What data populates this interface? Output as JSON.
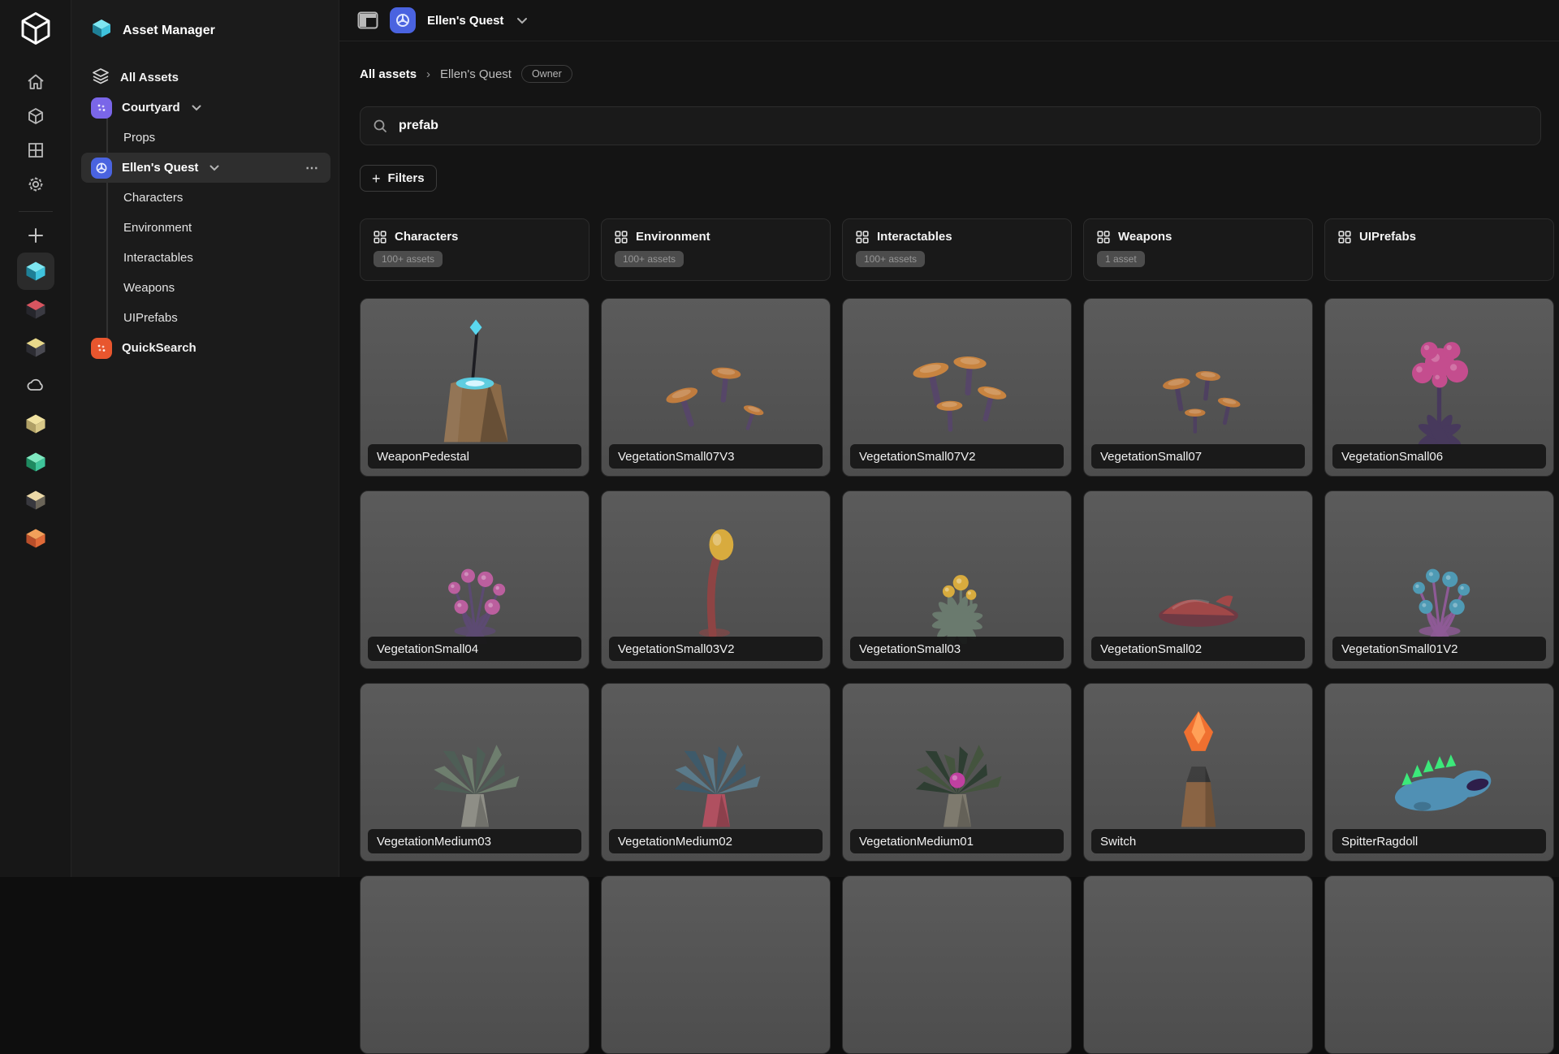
{
  "app_title": "Asset Manager",
  "colors": {
    "accent_blue": "#4a63e0",
    "purple": "#7a66e8",
    "orange": "#e8562e",
    "teal": "#3fc3dd",
    "card_grey": "#555555"
  },
  "rail": {
    "nav": [
      {
        "name": "home-icon"
      },
      {
        "name": "cube-icon"
      },
      {
        "name": "grid-icon"
      },
      {
        "name": "settings-gear-icon"
      }
    ],
    "add": {
      "name": "add-project-icon"
    },
    "projects": [
      {
        "name": "project-teal-cube",
        "selected": true,
        "kind": "cube",
        "top": "#7ee7f2",
        "left": "#1e7f96",
        "right": "#3fc3dd"
      },
      {
        "name": "project-red-cube",
        "selected": false,
        "kind": "cube",
        "top": "#d85560",
        "left": "#26262c",
        "right": "#3a3a42"
      },
      {
        "name": "project-amber-cube",
        "selected": false,
        "kind": "cube",
        "top": "#e8d88a",
        "left": "#2c2c32",
        "right": "#4a4a52"
      },
      {
        "name": "project-cloud",
        "selected": false,
        "kind": "cloud",
        "top": "#cccccc",
        "left": "#cccccc",
        "right": "#cccccc"
      },
      {
        "name": "project-cream-cube",
        "selected": false,
        "kind": "cube",
        "top": "#f0e2a0",
        "left": "#b0a066",
        "right": "#d8c888"
      },
      {
        "name": "project-green-cube",
        "selected": false,
        "kind": "cube",
        "top": "#7ee8c0",
        "left": "#1e8a60",
        "right": "#3ec49a"
      },
      {
        "name": "project-beige-cube",
        "selected": false,
        "kind": "cube",
        "top": "#ecd9a8",
        "left": "#38383e",
        "right": "#6a6458"
      },
      {
        "name": "project-orange-cube",
        "selected": false,
        "kind": "cube",
        "top": "#f2a05a",
        "left": "#b84e2a",
        "right": "#e06a38"
      }
    ]
  },
  "sidebar": {
    "header": {
      "label": "Asset Manager"
    },
    "items": [
      {
        "label": "All Assets",
        "type": "root",
        "icon": "layers"
      },
      {
        "label": "Courtyard",
        "type": "org",
        "icon_color": "#7a66e8",
        "chevron": true
      },
      {
        "label": "Props",
        "type": "sub"
      },
      {
        "label": "Ellen's Quest",
        "type": "org",
        "icon_color": "#4a63e0",
        "chevron": true,
        "selected": true,
        "more": "⋯"
      },
      {
        "label": "Characters",
        "type": "sub"
      },
      {
        "label": "Environment",
        "type": "sub"
      },
      {
        "label": "Interactables",
        "type": "sub"
      },
      {
        "label": "Weapons",
        "type": "sub"
      },
      {
        "label": "UIPrefabs",
        "type": "sub"
      },
      {
        "label": "QuickSearch",
        "type": "org",
        "icon_color": "#e8562e"
      }
    ]
  },
  "topbar": {
    "project": "Ellen's Quest"
  },
  "breadcrumb": {
    "root": "All assets",
    "separator": "›",
    "current": "Ellen's Quest",
    "chip": "Owner"
  },
  "search": {
    "value": "prefab"
  },
  "filters": {
    "plus": "+",
    "label": "Filters"
  },
  "categories": [
    {
      "label": "Characters",
      "count": "100+ assets"
    },
    {
      "label": "Environment",
      "count": "100+ assets"
    },
    {
      "label": "Interactables",
      "count": "100+ assets"
    },
    {
      "label": "Weapons",
      "count": "1 asset"
    },
    {
      "label": "UIPrefabs",
      "count": null
    }
  ],
  "assets": [
    {
      "name": "WeaponPedestal",
      "thumb": {
        "kind": "pedestal",
        "c1": "#8a6a48",
        "c2": "#5a4430",
        "c3": "#5ad8f0"
      }
    },
    {
      "name": "VegetationSmall07V3",
      "thumb": {
        "kind": "mushrooms",
        "variant": "sparse3",
        "cap": "#c07c3e",
        "stem": "#564668"
      }
    },
    {
      "name": "VegetationSmall07V2",
      "thumb": {
        "kind": "mushrooms",
        "variant": "cluster4",
        "cap": "#c88440",
        "stem": "#564668"
      }
    },
    {
      "name": "VegetationSmall07",
      "thumb": {
        "kind": "mushrooms",
        "variant": "small4",
        "cap": "#c07c3e",
        "stem": "#4e4060"
      }
    },
    {
      "name": "VegetationSmall06",
      "thumb": {
        "kind": "flower",
        "c1": "#c44d8e",
        "c2": "#47395c"
      }
    },
    {
      "name": "VegetationSmall04",
      "thumb": {
        "kind": "bulbs",
        "c1": "#bb5f9e",
        "c2": "#5c4a72"
      }
    },
    {
      "name": "VegetationSmall03V2",
      "thumb": {
        "kind": "tallbulb",
        "c1": "#d8ab3e",
        "c2": "#8e4444"
      }
    },
    {
      "name": "VegetationSmall03",
      "thumb": {
        "kind": "sprout",
        "c1": "#d8ab3e",
        "c2": "#6a7a6e"
      }
    },
    {
      "name": "VegetationSmall02",
      "thumb": {
        "kind": "mound",
        "c1": "#a04848",
        "c2": "#6e3a44"
      }
    },
    {
      "name": "VegetationSmall01V2",
      "thumb": {
        "kind": "bulbs",
        "c1": "#4f9ab4",
        "c2": "#8e5a96"
      }
    },
    {
      "name": "VegetationMedium03",
      "thumb": {
        "kind": "spiky",
        "c1": "#6e7e6e",
        "c2": "#4e5e56",
        "c3": "#8e8e86",
        "accent": null
      }
    },
    {
      "name": "VegetationMedium02",
      "thumb": {
        "kind": "spiky",
        "c1": "#5a7a8a",
        "c2": "#3e5a6a",
        "c3": "#b05060",
        "accent": null
      }
    },
    {
      "name": "VegetationMedium01",
      "thumb": {
        "kind": "spiky",
        "c1": "#44543e",
        "c2": "#2e3e32",
        "c3": "#7e7a6e",
        "accent": "#c040a0"
      }
    },
    {
      "name": "Switch",
      "thumb": {
        "kind": "gem",
        "c1": "#f07030",
        "c2": "#8a6444",
        "c3": "#ffa058"
      }
    },
    {
      "name": "SpitterRagdoll",
      "thumb": {
        "kind": "creature",
        "c1": "#5090b4",
        "c2": "#2e1e4a",
        "c3": "#3ce87a"
      }
    }
  ]
}
